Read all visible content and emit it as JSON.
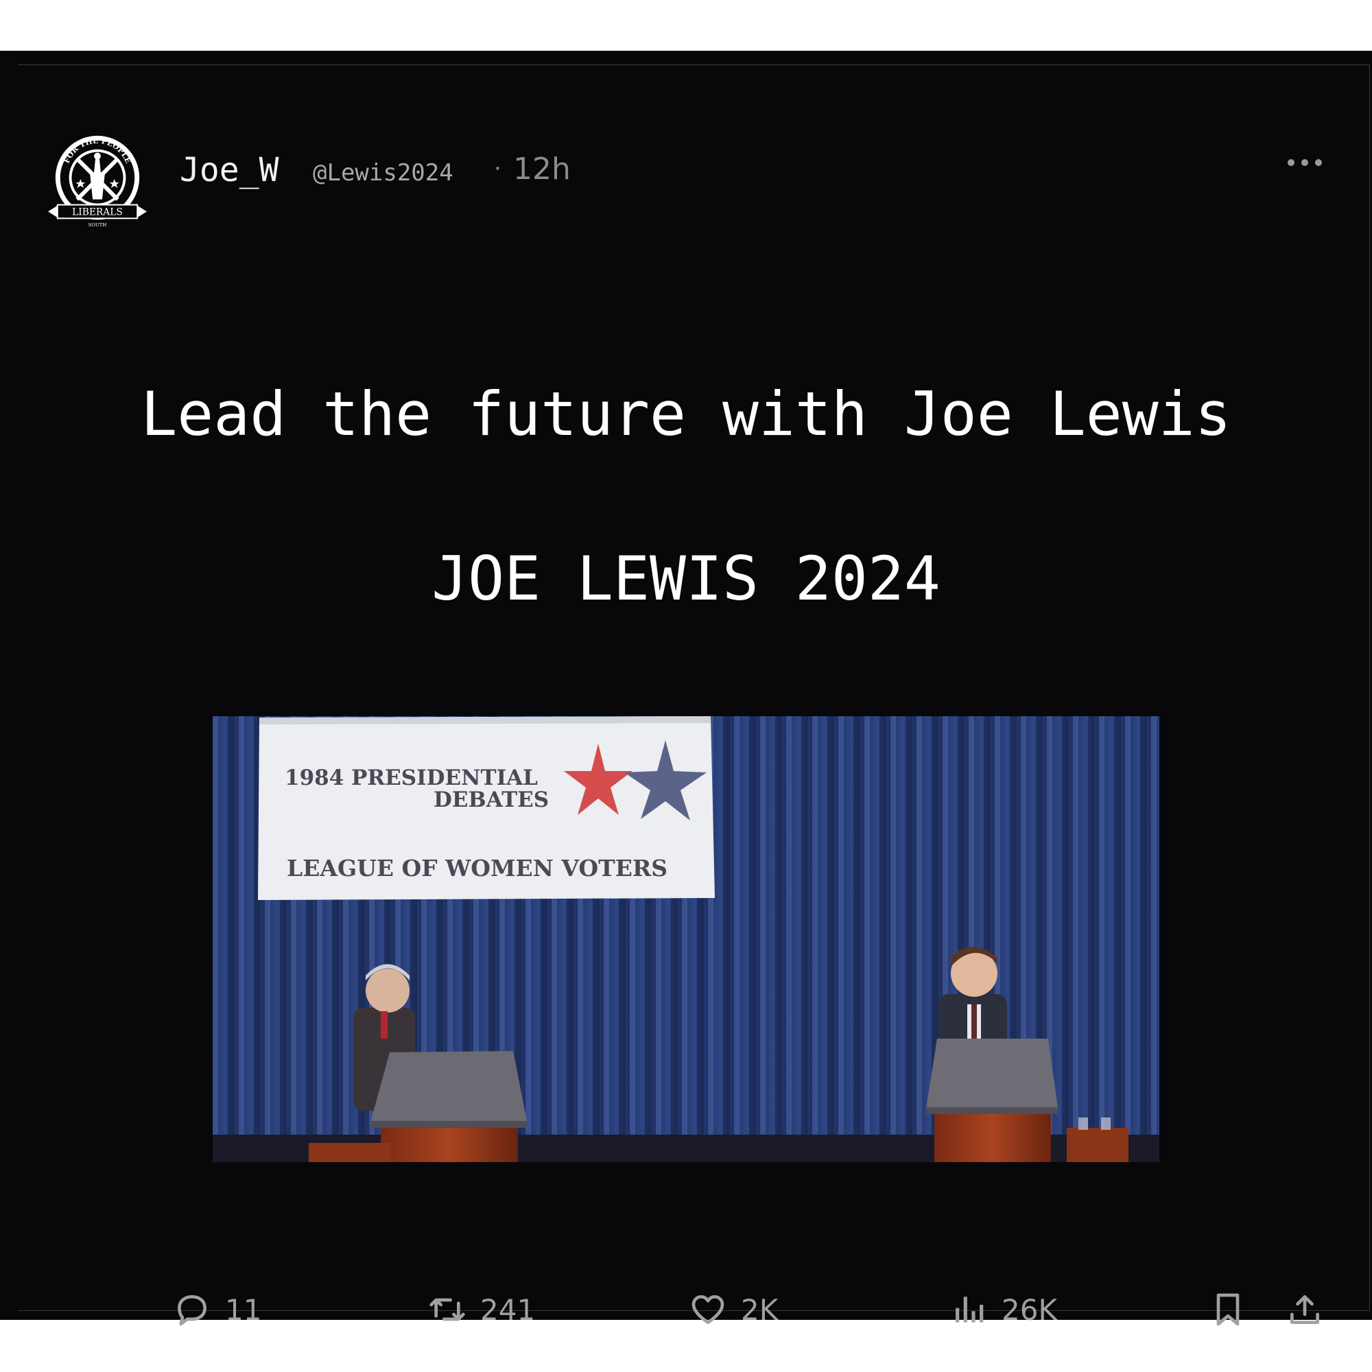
{
  "post": {
    "display_name": "Joe_W",
    "handle": "@Lewis2024",
    "separator": "·",
    "time": "12h",
    "avatar_text": {
      "top": "FOR THE PEOPLE",
      "ribbon": "LIBERALS",
      "bottom": "SOUTH"
    },
    "headline_1": "Lead the future with Joe Lewis",
    "headline_2": "JOE LEWIS 2024",
    "image": {
      "banner_line_1": "1984 PRESIDENTIAL",
      "banner_line_2": "DEBATES",
      "banner_line_3": "LEAGUE OF WOMEN VOTERS"
    }
  },
  "actions": {
    "replies": "11",
    "reposts": "241",
    "likes": "2K",
    "views": "26K"
  },
  "colors": {
    "background": "#08080a",
    "text": "#ffffff",
    "muted": "#8b8b8b",
    "curtain": "#2a3f78"
  }
}
